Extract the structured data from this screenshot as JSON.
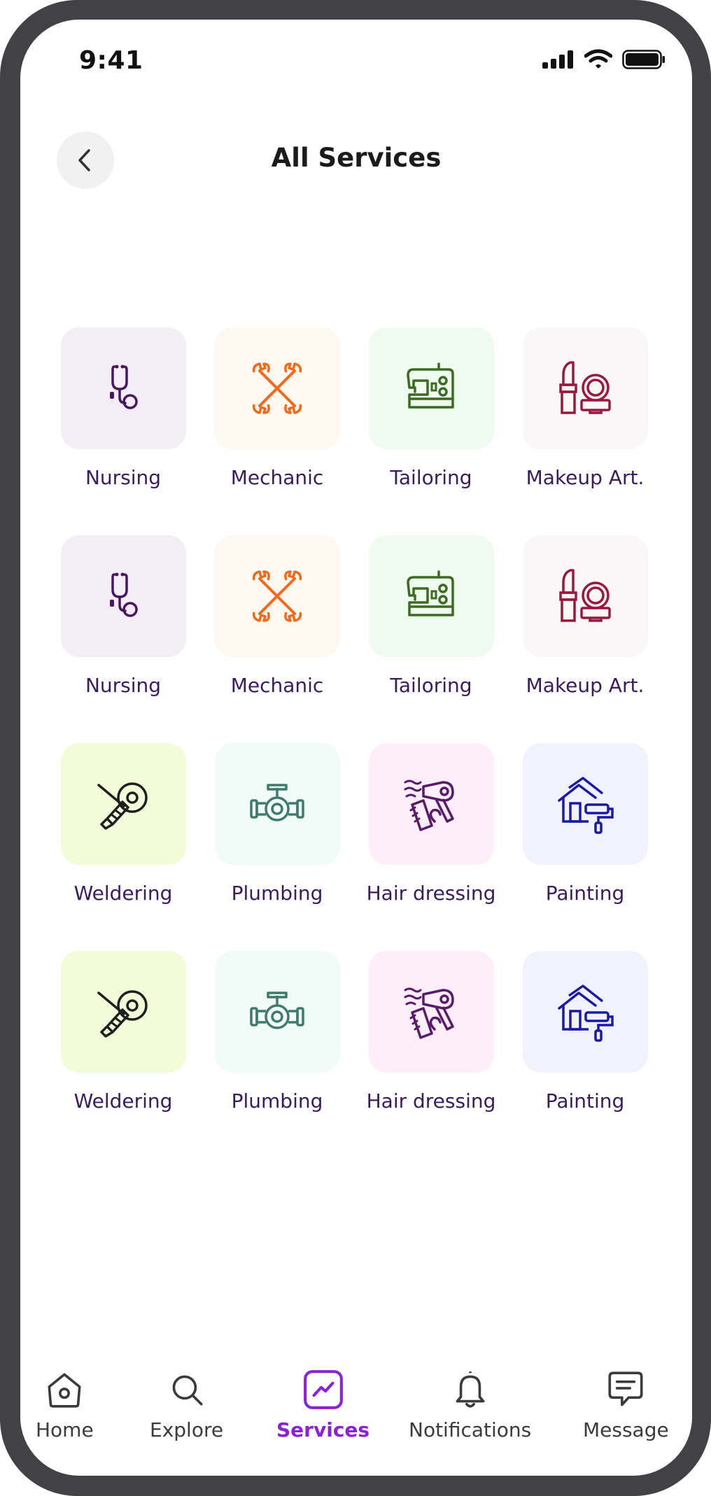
{
  "status_bar": {
    "time": "9:41"
  },
  "header": {
    "title": "All Services"
  },
  "services": [
    {
      "label": "Nursing",
      "icon": "stethoscope-icon",
      "bg": "#f3edf5",
      "color": "#4a1660"
    },
    {
      "label": "Mechanic",
      "icon": "crossed-wrenches-icon",
      "bg": "#fff8f0",
      "color": "#f26b1d"
    },
    {
      "label": "Tailoring",
      "icon": "sewing-machine-icon",
      "bg": "#eefbee",
      "color": "#3d6b22"
    },
    {
      "label": "Makeup Art.",
      "icon": "lipstick-compact-icon",
      "bg": "#f9f7f8",
      "color": "#9a1840"
    },
    {
      "label": "Nursing",
      "icon": "stethoscope-icon",
      "bg": "#f3edf5",
      "color": "#4a1660"
    },
    {
      "label": "Mechanic",
      "icon": "crossed-wrenches-icon",
      "bg": "#fff8f0",
      "color": "#f26b1d"
    },
    {
      "label": "Tailoring",
      "icon": "sewing-machine-icon",
      "bg": "#eefbee",
      "color": "#3d6b22"
    },
    {
      "label": "Makeup Art.",
      "icon": "lipstick-compact-icon",
      "bg": "#f9f7f8",
      "color": "#9a1840"
    },
    {
      "label": "Weldering",
      "icon": "angle-grinder-icon",
      "bg": "#f3fcd9",
      "color": "#1f1f1f"
    },
    {
      "label": "Plumbing",
      "icon": "pipe-valve-icon",
      "bg": "#f1fbf8",
      "color": "#3f7a6b"
    },
    {
      "label": "Hair dressing",
      "icon": "hair-dryer-comb-icon",
      "bg": "#fdeefa",
      "color": "#5a1a6a"
    },
    {
      "label": "Painting",
      "icon": "house-paint-roller-icon",
      "bg": "#f1f2fd",
      "color": "#1a1aa8"
    },
    {
      "label": "Weldering",
      "icon": "angle-grinder-icon",
      "bg": "#f3fcd9",
      "color": "#1f1f1f"
    },
    {
      "label": "Plumbing",
      "icon": "pipe-valve-icon",
      "bg": "#f1fbf8",
      "color": "#3f7a6b"
    },
    {
      "label": "Hair dressing",
      "icon": "hair-dryer-comb-icon",
      "bg": "#fdeefa",
      "color": "#5a1a6a"
    },
    {
      "label": "Painting",
      "icon": "house-paint-roller-icon",
      "bg": "#f1f2fd",
      "color": "#1a1aa8"
    }
  ],
  "nav": {
    "items": [
      {
        "label": "Home",
        "icon": "home-icon"
      },
      {
        "label": "Explore",
        "icon": "search-icon"
      },
      {
        "label": "Services",
        "icon": "chart-icon",
        "active": true
      },
      {
        "label": "Notifications",
        "icon": "bell-icon"
      },
      {
        "label": "Message",
        "icon": "chat-icon"
      }
    ]
  },
  "colors": {
    "accent": "#8a22d6",
    "label": "#3a1c5c",
    "bezel": "#424146"
  }
}
